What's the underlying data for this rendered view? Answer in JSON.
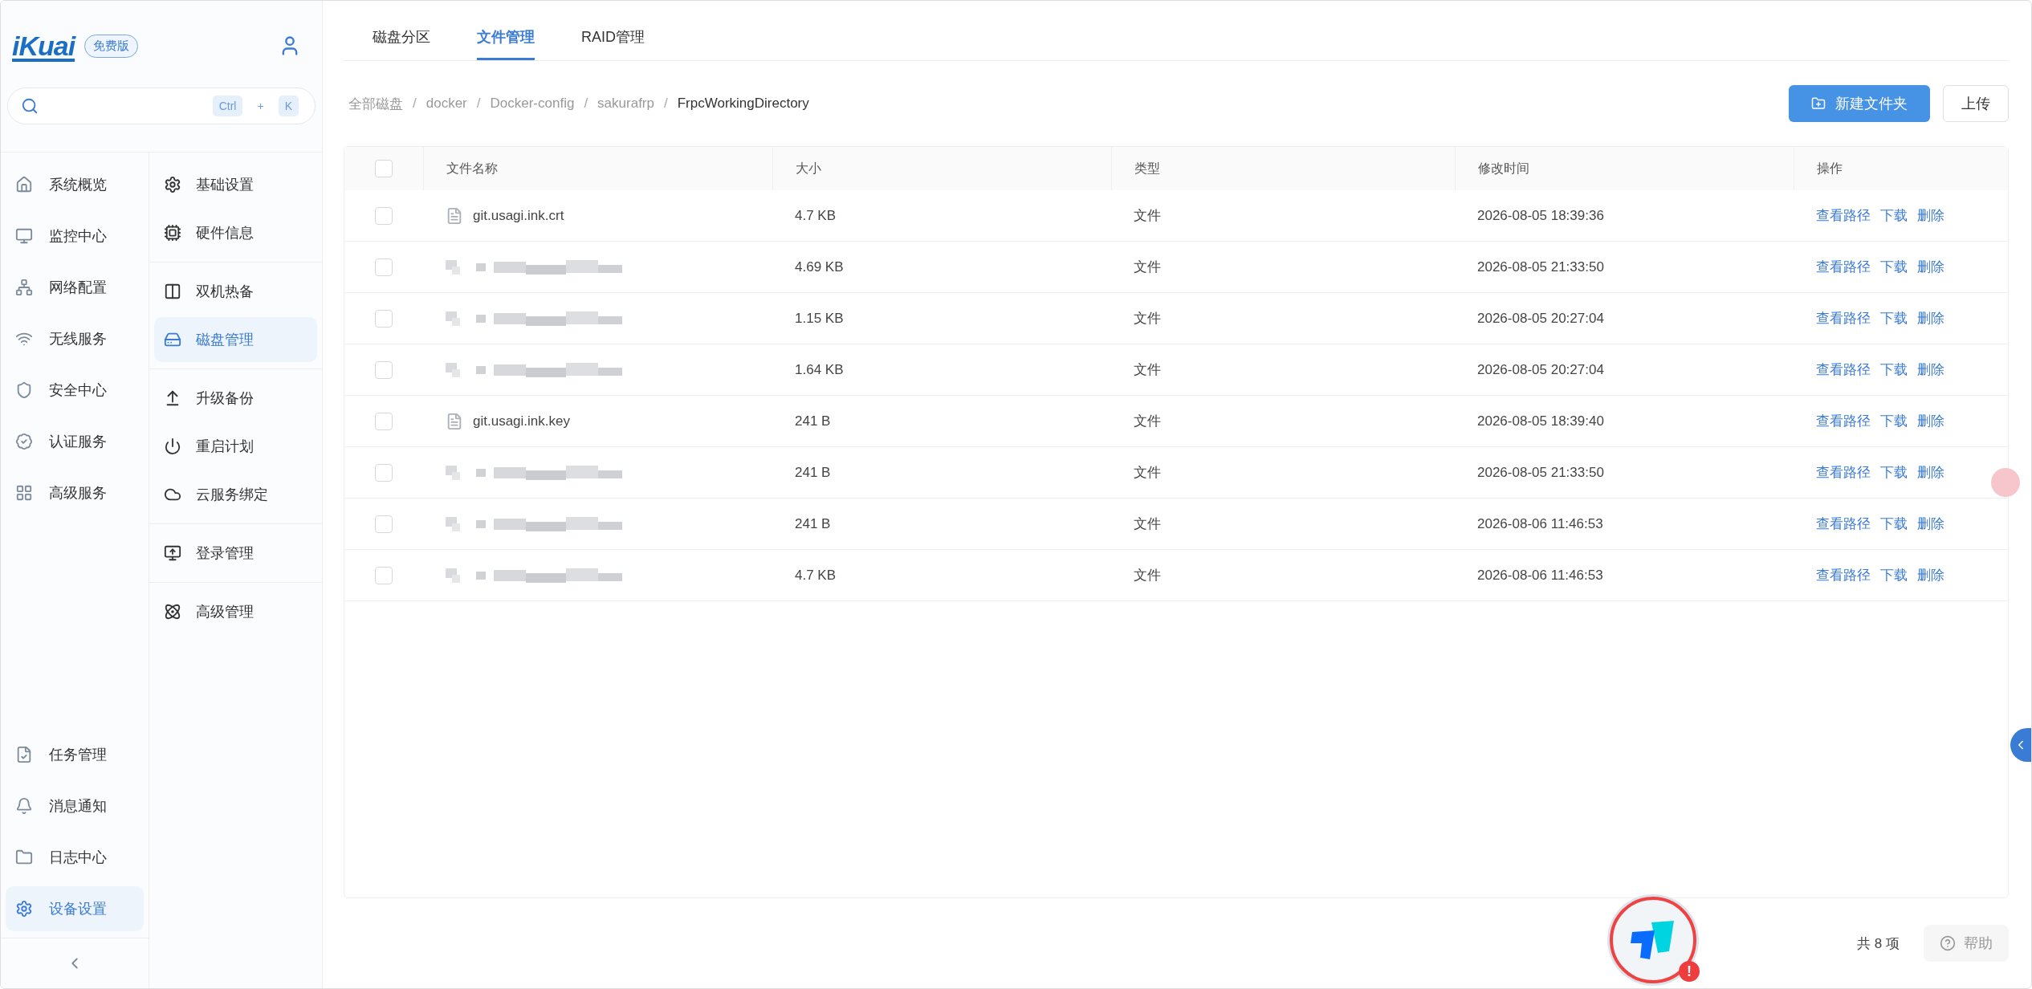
{
  "brand": {
    "logo": "iKuai",
    "edition": "免费版"
  },
  "search": {
    "keys": [
      "Ctrl",
      "+",
      "K"
    ]
  },
  "nav": {
    "items": [
      {
        "label": "系统概览",
        "selected": false
      },
      {
        "label": "监控中心",
        "selected": false
      },
      {
        "label": "网络配置",
        "selected": false
      },
      {
        "label": "无线服务",
        "selected": false
      },
      {
        "label": "安全中心",
        "selected": false
      },
      {
        "label": "认证服务",
        "selected": false
      },
      {
        "label": "高级服务",
        "selected": false
      }
    ],
    "bottom_items": [
      {
        "label": "任务管理",
        "selected": false
      },
      {
        "label": "消息通知",
        "selected": false
      },
      {
        "label": "日志中心",
        "selected": false
      },
      {
        "label": "设备设置",
        "selected": true
      }
    ]
  },
  "subnav": {
    "groups": [
      [
        {
          "label": "基础设置",
          "selected": false
        },
        {
          "label": "硬件信息",
          "selected": false
        }
      ],
      [
        {
          "label": "双机热备",
          "selected": false
        },
        {
          "label": "磁盘管理",
          "selected": true
        }
      ],
      [
        {
          "label": "升级备份",
          "selected": false
        },
        {
          "label": "重启计划",
          "selected": false
        },
        {
          "label": "云服务绑定",
          "selected": false
        }
      ],
      [
        {
          "label": "登录管理",
          "selected": false
        }
      ],
      [
        {
          "label": "高级管理",
          "selected": false
        }
      ]
    ]
  },
  "tabs": [
    {
      "label": "磁盘分区",
      "selected": false
    },
    {
      "label": "文件管理",
      "selected": true
    },
    {
      "label": "RAID管理",
      "selected": false
    }
  ],
  "breadcrumb": {
    "items": [
      "全部磁盘",
      "docker",
      "Docker-config",
      "sakurafrp",
      "FrpcWorkingDirectory"
    ],
    "separators": [
      "/",
      "/",
      "/",
      "/"
    ]
  },
  "actions": {
    "new_folder": "新建文件夹",
    "upload": "上传"
  },
  "table": {
    "select_all_checked": false,
    "columns": [
      "文件名称",
      "大小",
      "类型",
      "修改时间",
      "操作"
    ],
    "rows": [
      {
        "name": "git.usagi.ink.crt",
        "redacted": false,
        "size": "4.7 KB",
        "type": "文件",
        "modified": "2026-08-05 18:39:36",
        "checked": false,
        "actions": [
          "查看路径",
          "下载",
          "删除"
        ]
      },
      {
        "redacted": true,
        "size": "4.69 KB",
        "type": "文件",
        "modified": "2026-08-05 21:33:50",
        "checked": false,
        "actions": [
          "查看路径",
          "下载",
          "删除"
        ]
      },
      {
        "redacted": true,
        "size": "1.15 KB",
        "type": "文件",
        "modified": "2026-08-05 20:27:04",
        "checked": false,
        "actions": [
          "查看路径",
          "下载",
          "删除"
        ]
      },
      {
        "redacted": true,
        "size": "1.64 KB",
        "type": "文件",
        "modified": "2026-08-05 20:27:04",
        "checked": false,
        "actions": [
          "查看路径",
          "下载",
          "删除"
        ]
      },
      {
        "name": "git.usagi.ink.key",
        "redacted": false,
        "size": "241 B",
        "type": "文件",
        "modified": "2026-08-05 18:39:40",
        "checked": false,
        "actions": [
          "查看路径",
          "下载",
          "删除"
        ]
      },
      {
        "redacted": true,
        "size": "241 B",
        "type": "文件",
        "modified": "2026-08-05 21:33:50",
        "checked": false,
        "actions": [
          "查看路径",
          "下载",
          "删除"
        ]
      },
      {
        "redacted": true,
        "size": "241 B",
        "type": "文件",
        "modified": "2026-08-06 11:46:53",
        "checked": false,
        "actions": [
          "查看路径",
          "下载",
          "删除"
        ]
      },
      {
        "redacted": true,
        "size": "4.7 KB",
        "type": "文件",
        "modified": "2026-08-06 11:46:53",
        "checked": false,
        "actions": [
          "查看路径",
          "下载",
          "删除"
        ]
      }
    ]
  },
  "footer": {
    "total": "共 8 项",
    "help": "帮助"
  },
  "floating_badge": {
    "alert": "!"
  }
}
